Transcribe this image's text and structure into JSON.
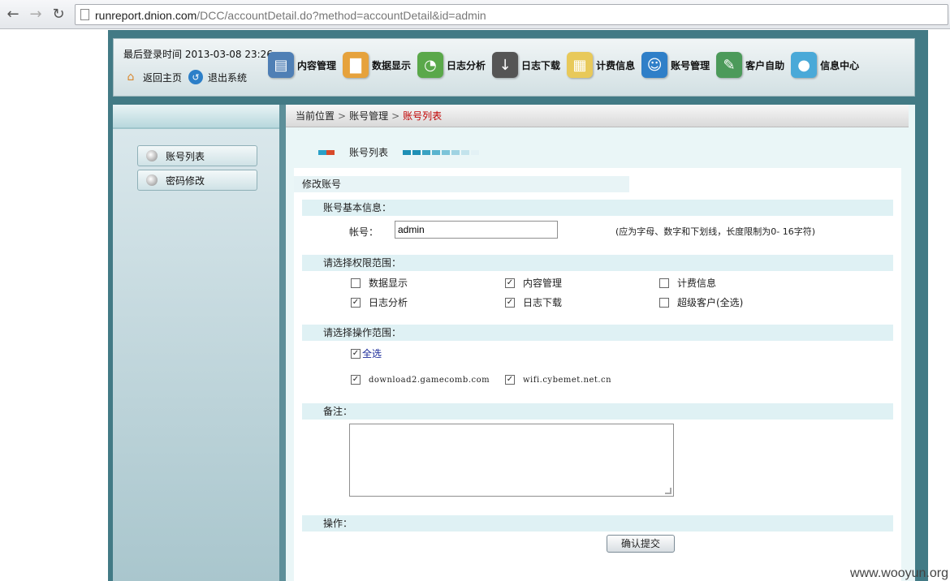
{
  "browser": {
    "url_host": "runreport.dnion.com",
    "url_rest": "/DCC/accountDetail.do?method=accountDetail&id=admin"
  },
  "header": {
    "login_time": "最后登录时间 2013-03-08  23:26",
    "home_label": "返回主页",
    "exit_label": "退出系统",
    "nav": [
      {
        "label": "内容管理",
        "icon": "laptop-icon",
        "color": "#4f7fb5"
      },
      {
        "label": "数据显示",
        "icon": "bar-chart-icon",
        "color": "#e6a23c"
      },
      {
        "label": "日志分析",
        "icon": "pie-chart-icon",
        "color": "#5aa84a"
      },
      {
        "label": "日志下载",
        "icon": "download-icon",
        "color": "#555555"
      },
      {
        "label": "计费信息",
        "icon": "calendar-icon",
        "color": "#e8c95a"
      },
      {
        "label": "账号管理",
        "icon": "users-icon",
        "color": "#2f7fc8"
      },
      {
        "label": "客户自助",
        "icon": "user-edit-icon",
        "color": "#4c9a5a"
      },
      {
        "label": "信息中心",
        "icon": "chat-icon",
        "color": "#4aa9d8"
      }
    ]
  },
  "sidebar": {
    "items": [
      {
        "label": "账号列表"
      },
      {
        "label": "密码修改"
      }
    ]
  },
  "breadcrumb": {
    "prefix": "当前位置",
    "sep": ">",
    "level1": "账号管理",
    "current": "账号列表"
  },
  "tab": {
    "title": "账号列表",
    "mark_colors": [
      "#2aa0c8",
      "#d84a2a"
    ],
    "bar_colors": [
      "#1f8fb5",
      "#1f8fb5",
      "#3aa2c2",
      "#5ab4cf",
      "#7cc4d9",
      "#9fd3e2",
      "#c3e3ec",
      "#e3f1f5"
    ]
  },
  "form": {
    "edit_title": "修改账号",
    "basic_section": "账号基本信息：",
    "account_label": "帐号：",
    "account_value": "admin",
    "account_hint": "(应为字母、数字和下划线，长度限制为0- 16字符)",
    "permission_section": "请选择权限范围：",
    "permissions": [
      {
        "label": "数据显示",
        "checked": false
      },
      {
        "label": "内容管理",
        "checked": true
      },
      {
        "label": "计费信息",
        "checked": false
      },
      {
        "label": "日志分析",
        "checked": true
      },
      {
        "label": "日志下载",
        "checked": true
      },
      {
        "label": "超级客户(全选)",
        "checked": false
      }
    ],
    "operation_section": "请选择操作范围：",
    "select_all": {
      "label": "全选",
      "checked": true
    },
    "domains": [
      {
        "label": "download2.gamecomb.com",
        "checked": true
      },
      {
        "label": "wifi.cybemet.net.cn",
        "checked": true
      }
    ],
    "remark_section": "备注：",
    "action_section": "操作：",
    "submit_label": "确认提交"
  },
  "watermark": "www.wooyun.org"
}
